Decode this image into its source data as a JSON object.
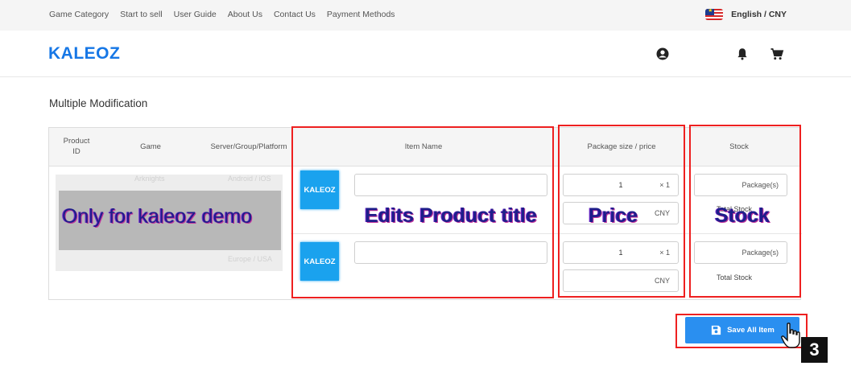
{
  "topbar": {
    "nav": [
      "Game Category",
      "Start to sell",
      "User Guide",
      "About Us",
      "Contact Us",
      "Payment Methods"
    ],
    "language": "English / CNY"
  },
  "header": {
    "logo": "KALEOZ",
    "icons": [
      "account-icon",
      "bell-icon",
      "cart-icon"
    ]
  },
  "page": {
    "title": "Multiple Modification"
  },
  "table": {
    "headers": {
      "product_id": "Product ID",
      "game": "Game",
      "server": "Server/Group/Platform",
      "item_name": "Item Name",
      "package": "Package size / price",
      "stock": "Stock"
    },
    "rows": [
      {
        "thumb_label": "KALEOZ",
        "item_name": "",
        "quantity": "1",
        "multiplier": "× 1",
        "price": "",
        "currency": "CNY",
        "stock_unit": "Package(s)",
        "total_stock_label": "Total Stock"
      },
      {
        "thumb_label": "KALEOZ",
        "item_name": "",
        "quantity": "1",
        "multiplier": "× 1",
        "price": "",
        "currency": "CNY",
        "stock_unit": "Package(s)",
        "total_stock_label": "Total Stock"
      }
    ],
    "blurred": {
      "game": "Arknights",
      "server1": "Android / iOS",
      "server2": "Europe / USA"
    }
  },
  "annotations": {
    "demo": "Only for kaleoz demo",
    "title": "Edits Product title",
    "price": "Price",
    "stock": "Stock",
    "step": "3"
  },
  "actions": {
    "save_label": "Save All Item"
  },
  "colors": {
    "brand": "#1677e6",
    "button": "#2a8ff0",
    "annotation": "#ee2020"
  }
}
